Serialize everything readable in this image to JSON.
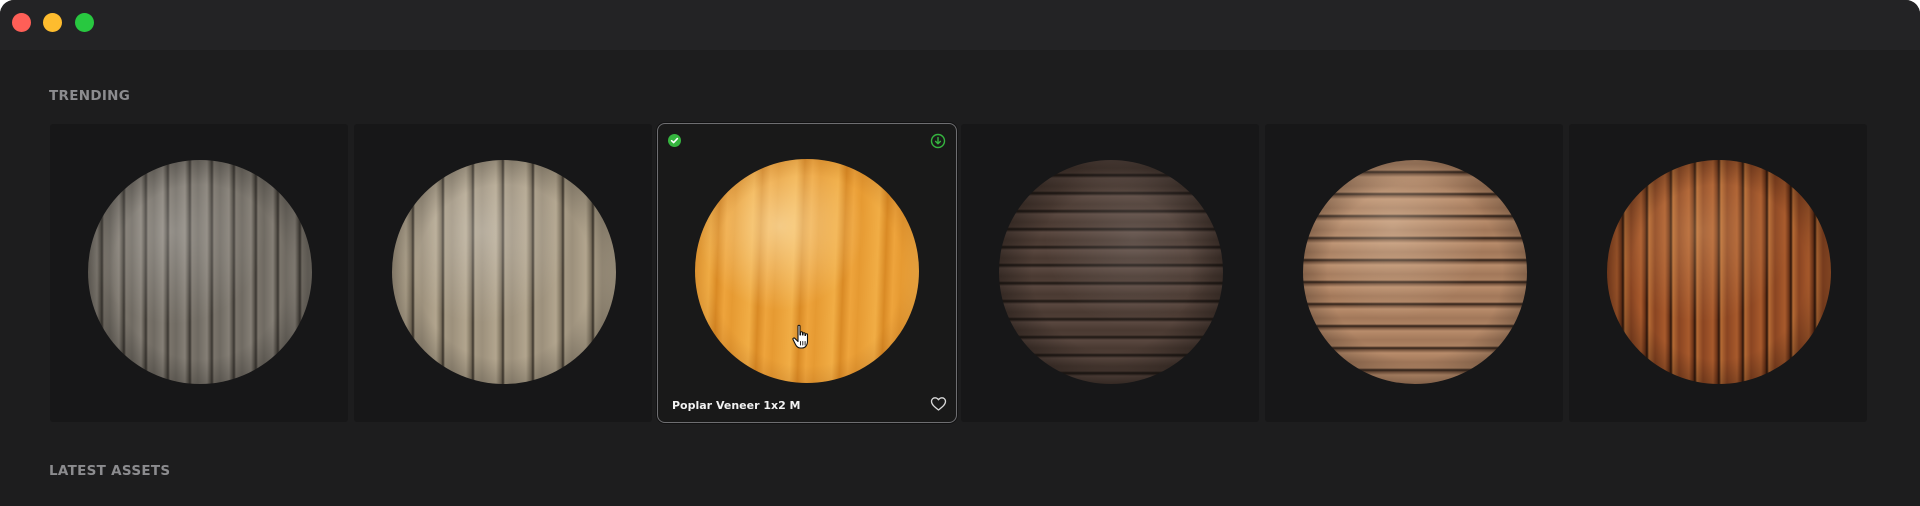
{
  "window": {
    "controls": [
      "close",
      "minimize",
      "maximize"
    ]
  },
  "sections": {
    "trending": "TRENDING",
    "latest": "LATEST ASSETS"
  },
  "trending": {
    "hovered_card": {
      "label": "Poplar Veneer 1x2 M",
      "icons": [
        "check-circle-icon",
        "download-icon",
        "heart-icon",
        "hand-cursor-icon"
      ]
    }
  },
  "colors": {
    "background": "#1d1d1e",
    "titlebar": "#232325",
    "card": "#171718",
    "section_title": "#8c8c8f",
    "check": "#35b53f",
    "close": "#fe5f57",
    "minimize": "#febc2e",
    "maximize": "#28c840"
  }
}
